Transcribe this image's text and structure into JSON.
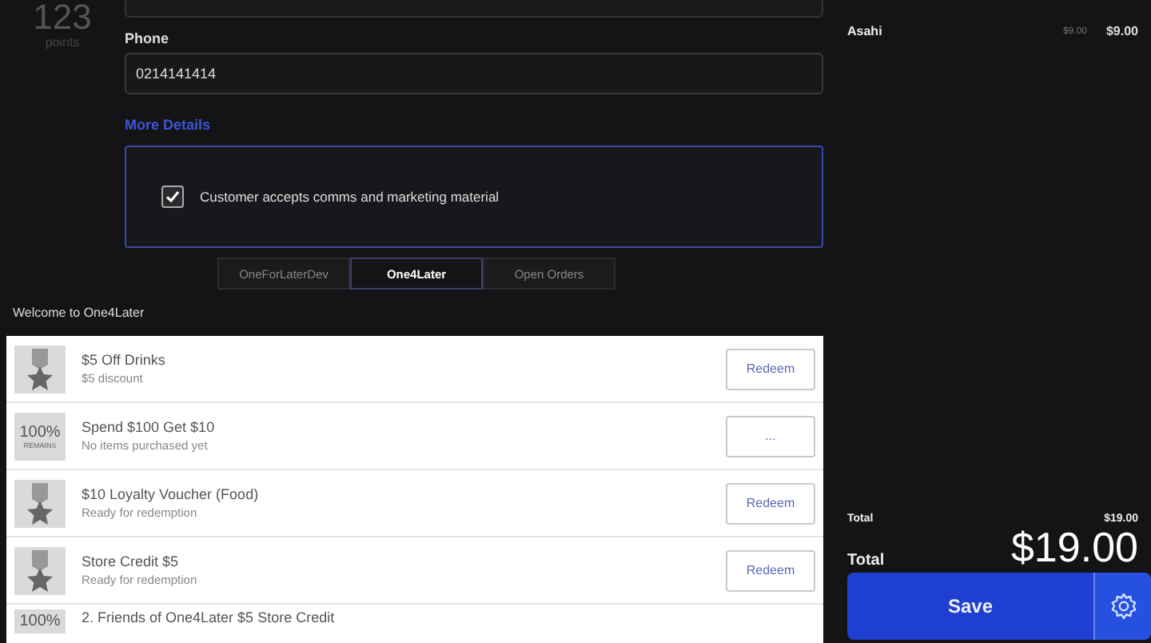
{
  "points": {
    "value": "123",
    "label": "points"
  },
  "form": {
    "phone_label": "Phone",
    "phone_value": "0214141414",
    "more_details": "More Details",
    "consent": {
      "label": "Customer accepts comms and marketing material",
      "checked": true
    }
  },
  "tabs": [
    {
      "label": "OneForLaterDev",
      "selected": false
    },
    {
      "label": "One4Later",
      "selected": true
    },
    {
      "label": "Open Orders",
      "selected": false
    }
  ],
  "welcome": "Welcome to One4Later",
  "rewards": [
    {
      "kind": "medal",
      "title": "$5 Off Drinks",
      "subtitle": "$5 discount",
      "action": "Redeem"
    },
    {
      "kind": "progress",
      "percent": "100%",
      "caption": "REMAINS",
      "title": "Spend $100 Get $10",
      "subtitle": "No items purchased yet",
      "action": "..."
    },
    {
      "kind": "medal",
      "title": "$10 Loyalty Voucher (Food)",
      "subtitle": "Ready for redemption",
      "action": "Redeem"
    },
    {
      "kind": "medal",
      "title": "Store Credit $5",
      "subtitle": "Ready for redemption",
      "action": "Redeem"
    },
    {
      "kind": "progress",
      "percent": "100%",
      "title": "2. Friends of One4Later $5 Store Credit"
    }
  ],
  "order": {
    "items": [
      {
        "name": "Asahi",
        "unit_price": "$9.00",
        "price": "$9.00"
      }
    ],
    "subtotal_label": "Total",
    "subtotal": "$19.00",
    "total_label": "Total",
    "total": "$19.00",
    "save": "Save"
  }
}
